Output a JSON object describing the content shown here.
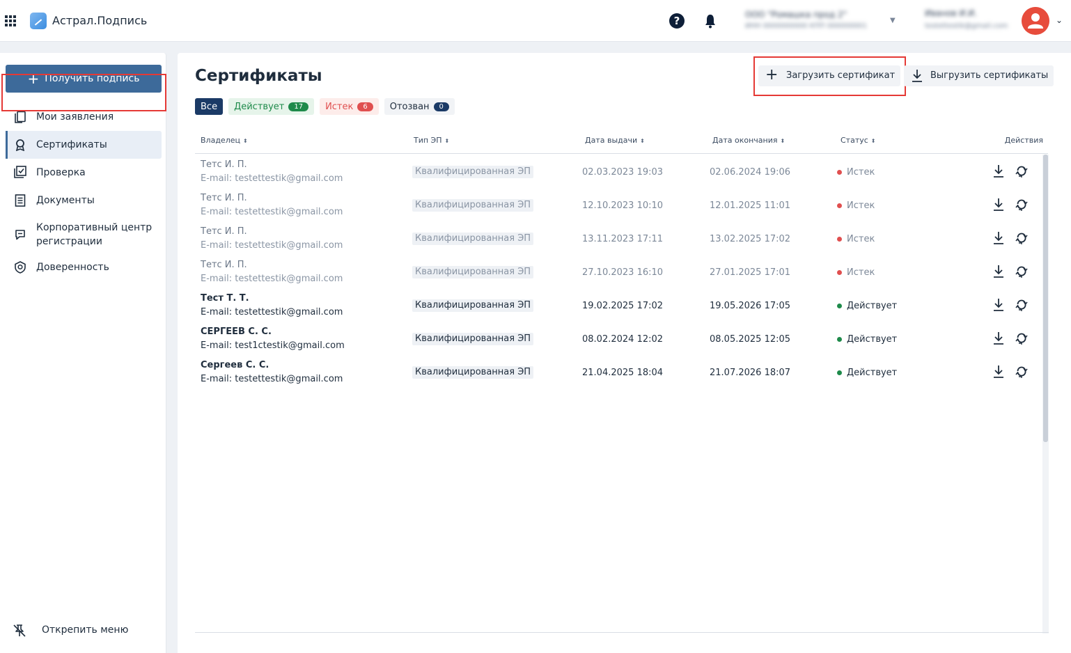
{
  "header": {
    "app_title": "Астрал.Подпись",
    "apps_icon": "apps-grid-icon",
    "help_icon": "help-icon",
    "bell_icon": "bell-icon",
    "org_name": "ООО \"Ромашка прод 2\"",
    "org_sub": "ИНН 0000000000 КПП 000000001",
    "user_name": "Иванов И.И.",
    "user_email": "testettestik@gmail.com",
    "avatar_color": "#e74c3c"
  },
  "sidebar": {
    "get_sign_label": "Получить подпись",
    "items": [
      {
        "label": "Мои заявления",
        "icon": "documents-copy-icon"
      },
      {
        "label": "Сертификаты",
        "icon": "award-icon",
        "active": true
      },
      {
        "label": "Проверка",
        "icon": "check-square-icon"
      },
      {
        "label": "Документы",
        "icon": "document-lines-icon"
      },
      {
        "label": "Корпоративный центр регистрации",
        "icon": "chat-bubble-icon"
      },
      {
        "label": "Доверенность",
        "icon": "shield-badge-icon"
      }
    ],
    "unpin_label": "Открепить меню"
  },
  "main": {
    "title": "Сертификаты",
    "upload_label": "Загрузить сертификат",
    "export_label": "Выгрузить сертификаты",
    "filters": {
      "all": "Все",
      "active": "Действует",
      "active_count": "17",
      "expired": "Истек",
      "expired_count": "6",
      "revoked": "Отозван",
      "revoked_count": "0"
    },
    "columns": {
      "owner": "Владелец",
      "type": "Тип ЭП",
      "issued": "Дата выдачи",
      "expires": "Дата окончания",
      "status": "Статус",
      "actions": "Действия"
    },
    "rows": [
      {
        "name": "Тетс И. П.",
        "email": "E-mail: testettestik@gmail.com",
        "type": "Квалифицированная ЭП",
        "issued": "02.03.2023 19:03",
        "expires": "02.06.2024 19:06",
        "status": "Истек"
      },
      {
        "name": "Тетс И. П.",
        "email": "E-mail: testettestik@gmail.com",
        "type": "Квалифицированная ЭП",
        "issued": "12.10.2023 10:10",
        "expires": "12.01.2025 11:01",
        "status": "Истек"
      },
      {
        "name": "Тетс И. П.",
        "email": "E-mail: testettestik@gmail.com",
        "type": "Квалифицированная ЭП",
        "issued": "13.11.2023 17:11",
        "expires": "13.02.2025 17:02",
        "status": "Истек"
      },
      {
        "name": "Тетс И. П.",
        "email": "E-mail: testettestik@gmail.com",
        "type": "Квалифицированная ЭП",
        "issued": "27.10.2023 16:10",
        "expires": "27.01.2025 17:01",
        "status": "Истек"
      },
      {
        "name": "Тест Т. Т.",
        "email": "E-mail: testettestik@gmail.com",
        "type": "Квалифицированная ЭП",
        "issued": "19.02.2025 17:02",
        "expires": "19.05.2026 17:05",
        "status": "Действует"
      },
      {
        "name": "СЕРГЕЕВ С. С.",
        "email": "E-mail: test1ctestik@gmail.com",
        "type": "Квалифицированная ЭП",
        "issued": "08.02.2024 12:02",
        "expires": "08.05.2025 12:05",
        "status": "Действует"
      },
      {
        "name": "Сергеев С. С.",
        "email": "E-mail: testettestik@gmail.com",
        "type": "Квалифицированная ЭП",
        "issued": "21.04.2025 18:04",
        "expires": "21.07.2026 18:07",
        "status": "Действует"
      }
    ]
  },
  "colors": {
    "primary": "#3d6a9a",
    "navy": "#1b3a66",
    "status_active": "#1e8a4a",
    "status_expired": "#e04f4f",
    "highlight": "#e53935"
  }
}
